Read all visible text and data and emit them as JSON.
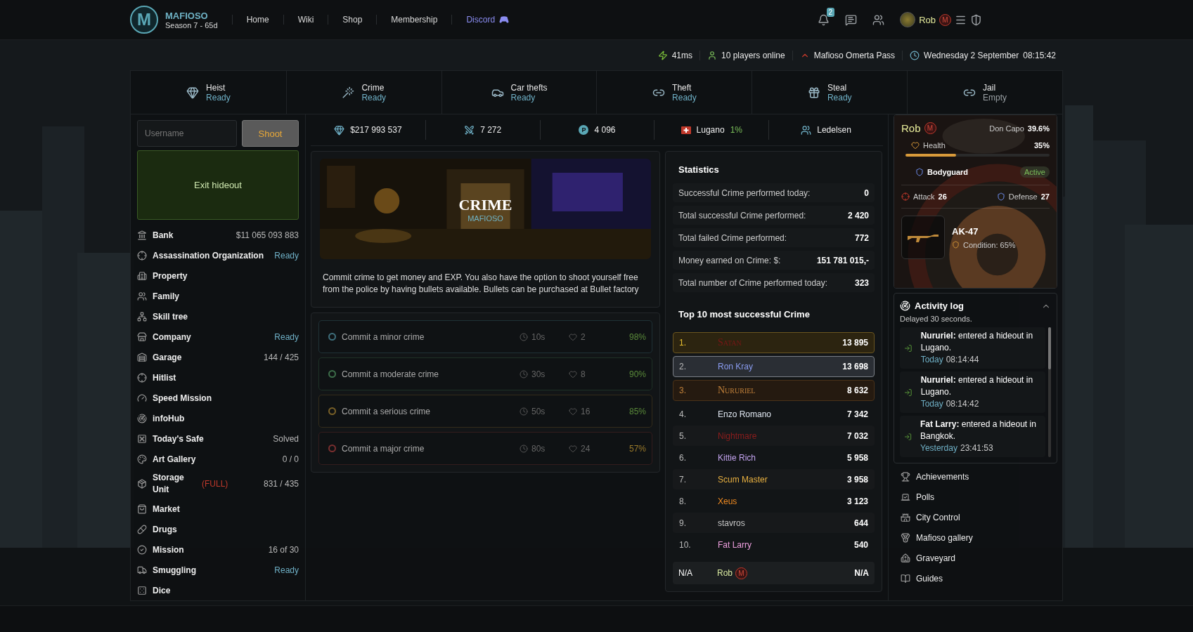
{
  "nav": {
    "logo_letter": "M",
    "brand": "MAFIOSO",
    "season": "Season 7 - 65d",
    "links": [
      {
        "label": "Home",
        "kind": "plain"
      },
      {
        "label": "Wiki",
        "kind": "plain"
      },
      {
        "label": "Shop",
        "kind": "plain"
      },
      {
        "label": "Membership",
        "kind": "plain"
      },
      {
        "label": "Discord",
        "kind": "discord"
      }
    ],
    "notifications": "2",
    "user": "Rob",
    "user_badge": "M"
  },
  "info_bar": {
    "ping": "41ms",
    "online": "10 players online",
    "pass": "Mafioso Omerta Pass",
    "date": "Wednesday 2 September",
    "time": "08:15:42"
  },
  "actions": [
    {
      "label": "Heist",
      "status": "Ready",
      "ready": true
    },
    {
      "label": "Crime",
      "status": "Ready",
      "ready": true
    },
    {
      "label": "Car thefts",
      "status": "Ready",
      "ready": true
    },
    {
      "label": "Theft",
      "status": "Ready",
      "ready": true
    },
    {
      "label": "Steal",
      "status": "Ready",
      "ready": true
    },
    {
      "label": "Jail",
      "status": "Empty",
      "ready": false
    }
  ],
  "shoot": {
    "placeholder": "Username",
    "button": "Shoot"
  },
  "exit_button": "Exit hideout",
  "sidebar": [
    {
      "label": "Bank",
      "value": "$11 065 093 883",
      "kind": "count"
    },
    {
      "label": "Assassination Organization",
      "value": "Ready",
      "kind": "status"
    },
    {
      "label": "Property"
    },
    {
      "label": "Family"
    },
    {
      "label": "Skill tree"
    },
    {
      "label": "Company",
      "value": "Ready",
      "kind": "status"
    },
    {
      "label": "Garage",
      "value": "144 / 425",
      "kind": "count"
    },
    {
      "label": "Hitlist"
    },
    {
      "label": "Speed Mission"
    },
    {
      "label": "infoHub"
    },
    {
      "label": "Today's Safe",
      "value": "Solved",
      "kind": "count"
    },
    {
      "label": "Art Gallery",
      "value": "0 / 0",
      "kind": "count"
    },
    {
      "label": "Storage Unit",
      "value": "831 / 435",
      "kind": "count",
      "tag": "(FULL)"
    },
    {
      "label": "Market"
    },
    {
      "label": "Drugs"
    },
    {
      "label": "Mission",
      "value": "16 of 30",
      "kind": "count"
    },
    {
      "label": "Smuggling",
      "value": "Ready",
      "kind": "status"
    },
    {
      "label": "Dice"
    }
  ],
  "stats_bar": {
    "money": "$217 993 537",
    "bullets": "7 272",
    "points": "4 096",
    "points_letter": "P",
    "city": "Lugano",
    "city_pct": "1%",
    "family": "Ledelsen"
  },
  "crime": {
    "banner_title": "CRIME",
    "banner_subtitle": "MAFIOSO",
    "description": "Commit crime to get money and EXP. You also have the option to shoot yourself free from the police by having bullets available. Bullets can be purchased at Bullet factory",
    "options": [
      {
        "label": "Commit a minor crime",
        "color": "#3f6f7c",
        "time": "10s",
        "cost": "2",
        "chance": "98%",
        "warning": false
      },
      {
        "label": "Commit a moderate crime",
        "color": "#3d6e4a",
        "time": "30s",
        "cost": "8",
        "chance": "90%",
        "warning": false
      },
      {
        "label": "Commit a serious crime",
        "color": "#7a6128",
        "time": "50s",
        "cost": "16",
        "chance": "85%",
        "warning": false
      },
      {
        "label": "Commit a major crime",
        "color": "#7a2f2f",
        "time": "80s",
        "cost": "24",
        "chance": "57%",
        "warning": true
      }
    ]
  },
  "statistics": {
    "title": "Statistics",
    "rows": [
      {
        "label": "Successful Crime performed today:",
        "value": "0"
      },
      {
        "label": "Total successful Crime performed:",
        "value": "2 420"
      },
      {
        "label": "Total failed Crime performed:",
        "value": "772"
      },
      {
        "label": "Money earned on Crime: $:",
        "value": "151 781 015,-"
      },
      {
        "label": "Total number of Crime performed today:",
        "value": "323"
      }
    ]
  },
  "top10": {
    "title": "Top 10 most successful Crime",
    "rows": [
      {
        "rank": "1.",
        "name": "Satan",
        "score": "13 895",
        "kind": "gold",
        "color": "#7a1616",
        "fancy": true
      },
      {
        "rank": "2.",
        "name": "Ron Kray",
        "score": "13 698",
        "kind": "silver",
        "color": "#8a9cf0",
        "fancy": false
      },
      {
        "rank": "3.",
        "name": "Nururiel",
        "score": "8 632",
        "kind": "bronze",
        "color": "#c0803a",
        "fancy": true
      },
      {
        "rank": "4.",
        "name": "Enzo Romano",
        "score": "7 342",
        "kind": "plain",
        "color": "#dfe6f0",
        "fancy": false
      },
      {
        "rank": "5.",
        "name": "Nightmare",
        "score": "7 032",
        "kind": "shaded",
        "color": "#8e1d1d",
        "fancy": false
      },
      {
        "rank": "6.",
        "name": "Kittie Rich",
        "score": "5 958",
        "kind": "plain",
        "color": "#c4a4f0",
        "fancy": false
      },
      {
        "rank": "7.",
        "name": "Scum Master",
        "score": "3 958",
        "kind": "shaded",
        "color": "#e8b040",
        "fancy": false
      },
      {
        "rank": "8.",
        "name": "Xeus",
        "score": "3 123",
        "kind": "plain",
        "color": "#f08a20",
        "fancy": false
      },
      {
        "rank": "9.",
        "name": "stavros",
        "score": "644",
        "kind": "shaded",
        "color": "#c8c8c8",
        "fancy": false
      },
      {
        "rank": "10.",
        "name": "Fat Larry",
        "score": "540",
        "kind": "plain",
        "color": "#f0a0e0",
        "fancy": false
      }
    ],
    "own": {
      "rank": "N/A",
      "name": "Rob",
      "badge": "M",
      "score": "N/A"
    }
  },
  "profile": {
    "name": "Rob",
    "badge": "M",
    "rank": "Don Capo",
    "rank_pct": "39.6%",
    "health_label": "Health",
    "health_pct": "35%",
    "level": 0.35,
    "bodyguard": "Bodyguard",
    "bodyguard_status": "Active",
    "attack_label": "Attack",
    "attack": "26",
    "defense_label": "Defense",
    "defense": "27",
    "weapon": "AK-47",
    "condition": "Condition: 65%"
  },
  "activity": {
    "title": "Activity log",
    "subtitle": "Delayed 30 seconds.",
    "expanded": true,
    "entries": [
      {
        "text": "**Nururiel:** entered a hideout in Lugano.",
        "day": "Today",
        "time": "08:14:44"
      },
      {
        "text": "**Nururiel:** entered a hideout in Lugano.",
        "day": "Today",
        "time": "08:14:42"
      },
      {
        "text": "**Fat Larry:** entered a hideout in Bangkok.",
        "day": "Yesterday",
        "time": "23:41:53"
      }
    ]
  },
  "right_menu": [
    "Achievements",
    "Polls",
    "City Control",
    "Mafioso gallery",
    "Graveyard",
    "Guides"
  ]
}
